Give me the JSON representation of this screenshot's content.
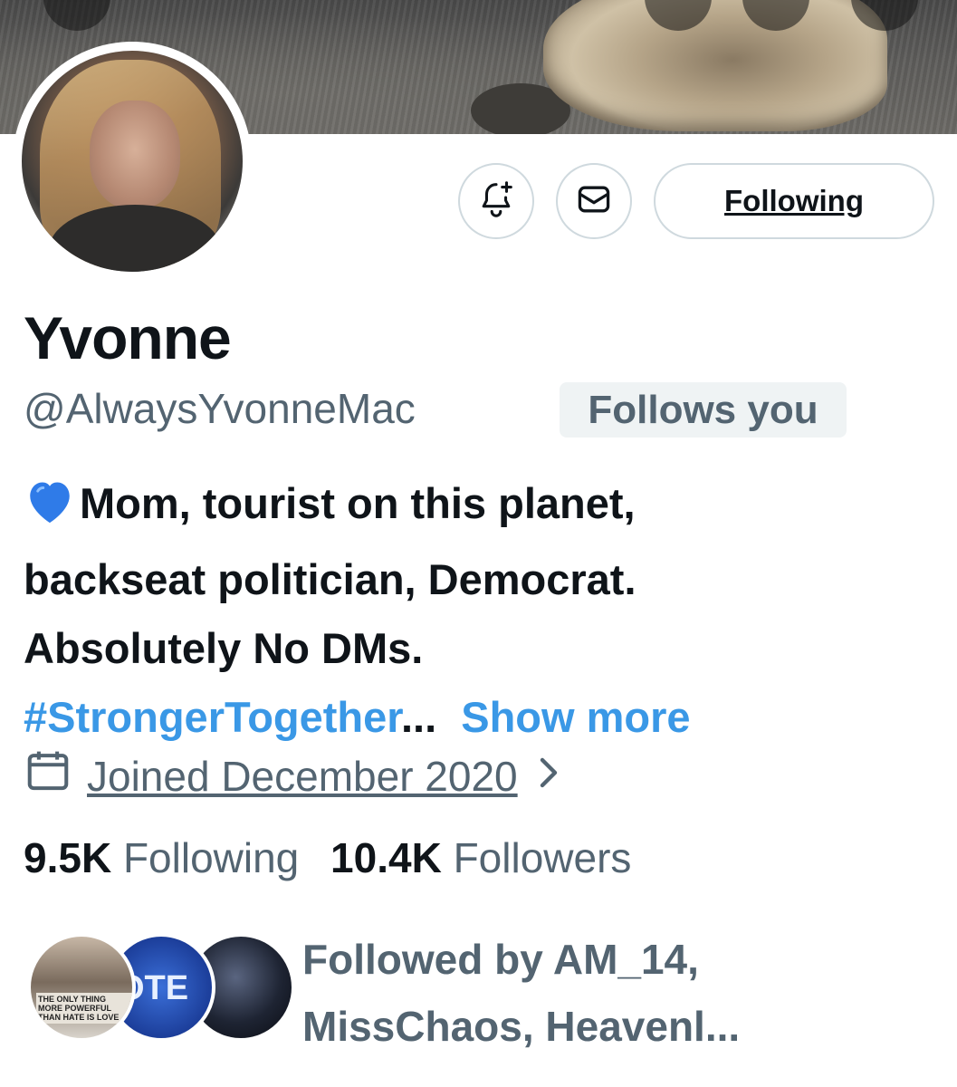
{
  "profile": {
    "name": "Yvonne",
    "handle": "@AlwaysYvonneMac",
    "follows_you_badge": "Follows you",
    "bio": {
      "line1": "Mom, tourist on this planet,",
      "line2": "backseat politician, Democrat.",
      "line3": "Absolutely No DMs.",
      "hashtag": "#StrongerTogether",
      "ellipsis": "...",
      "show_more": "Show more"
    },
    "joined": "Joined December 2020",
    "stats": {
      "following_count": "9.5K",
      "following_label": "Following",
      "followers_count": "10.4K",
      "followers_label": "Followers"
    },
    "followed_by": {
      "line1": "Followed by AM_14,",
      "line2": "MissChaos, Heavenl..."
    }
  },
  "actions": {
    "following_button": "Following"
  },
  "mutual_avatar_texts": {
    "first": "THE ONLY THING MORE POWERFUL THAN HATE IS LOVE",
    "second": "OTE"
  },
  "icons": [
    "notification-bell-add-icon",
    "message-envelope-icon",
    "calendar-icon",
    "chevron-right-icon",
    "blue-heart-icon"
  ],
  "colors": {
    "link_blue": "#3a98e6",
    "secondary_text": "#536471",
    "primary_text": "#0f1419",
    "badge_bg": "#eff3f4",
    "border": "#cfd9de"
  }
}
